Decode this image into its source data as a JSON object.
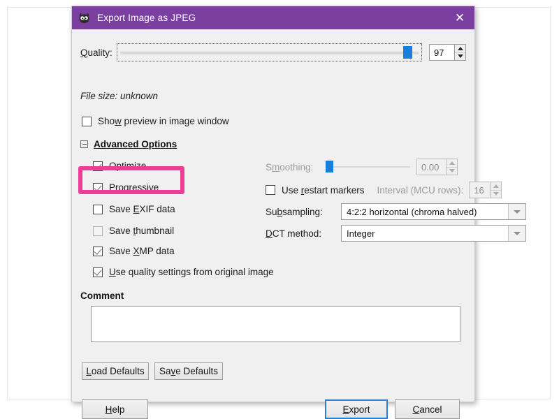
{
  "window": {
    "title": "Export Image as JPEG",
    "icon": "gimp-wilber-icon",
    "close_label": "✕",
    "titlebar_color": "#7b3fa0"
  },
  "quality": {
    "label": "Quality:",
    "value": "97",
    "slider_percent": 97
  },
  "file_size": {
    "text": "File size: unknown"
  },
  "preview": {
    "label": "Show preview in image window",
    "checked": false
  },
  "advanced_options": {
    "label": "Advanced Options",
    "expanded": true,
    "left_checkboxes": [
      {
        "label": "Optimize",
        "checked": true,
        "disabled": false
      },
      {
        "label": "Progressive",
        "checked": true,
        "disabled": false
      },
      {
        "label": "Save EXIF data",
        "checked": false,
        "disabled": false
      },
      {
        "label": "Save thumbnail",
        "checked": false,
        "disabled": true
      },
      {
        "label": "Save XMP data",
        "checked": true,
        "disabled": false
      },
      {
        "label": "Use quality settings from original image",
        "checked": true,
        "disabled": false
      }
    ],
    "smoothing": {
      "label": "Smoothing:",
      "value": "0.00",
      "slider_percent": 0,
      "disabled": true
    },
    "restart_markers": {
      "label": "Use restart markers",
      "checked": false
    },
    "interval": {
      "label": "Interval (MCU rows):",
      "value": "16",
      "disabled": true
    },
    "subsampling": {
      "label": "Subsampling:",
      "value": "4:2:2 horizontal (chroma halved)"
    },
    "dct_method": {
      "label": "DCT method:",
      "value": "Integer"
    }
  },
  "comment": {
    "label": "Comment",
    "value": "",
    "placeholder": ""
  },
  "defaults_buttons": {
    "load": "Load Defaults",
    "save": "Save Defaults"
  },
  "action_buttons": {
    "help": "Help",
    "export": "Export",
    "cancel": "Cancel"
  },
  "annotation": {
    "highlight_target": "Save EXIF data",
    "highlight_color": "#ee3d96"
  }
}
